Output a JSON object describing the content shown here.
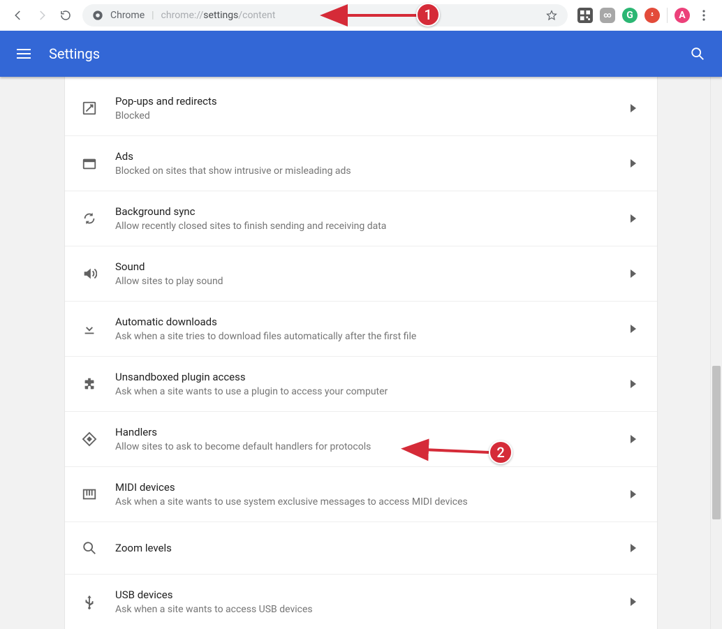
{
  "toolbar": {
    "url_label": "Chrome",
    "url_prefix": "chrome://",
    "url_strong": "settings",
    "url_suffix": "/content"
  },
  "header": {
    "title": "Settings"
  },
  "rows": [
    {
      "title": "Pop-ups and redirects",
      "subtitle": "Blocked"
    },
    {
      "title": "Ads",
      "subtitle": "Blocked on sites that show intrusive or misleading ads"
    },
    {
      "title": "Background sync",
      "subtitle": "Allow recently closed sites to finish sending and receiving data"
    },
    {
      "title": "Sound",
      "subtitle": "Allow sites to play sound"
    },
    {
      "title": "Automatic downloads",
      "subtitle": "Ask when a site tries to download files automatically after the first file"
    },
    {
      "title": "Unsandboxed plugin access",
      "subtitle": "Ask when a site wants to use a plugin to access your computer"
    },
    {
      "title": "Handlers",
      "subtitle": "Allow sites to ask to become default handlers for protocols"
    },
    {
      "title": "MIDI devices",
      "subtitle": "Ask when a site wants to use system exclusive messages to access MIDI devices"
    },
    {
      "title": "Zoom levels",
      "subtitle": ""
    },
    {
      "title": "USB devices",
      "subtitle": "Ask when a site wants to access USB devices"
    }
  ],
  "annotations": {
    "badge1": "1",
    "badge2": "2"
  },
  "extensions": {
    "grammarly": "G",
    "infinity": "∞",
    "profile": "A"
  }
}
